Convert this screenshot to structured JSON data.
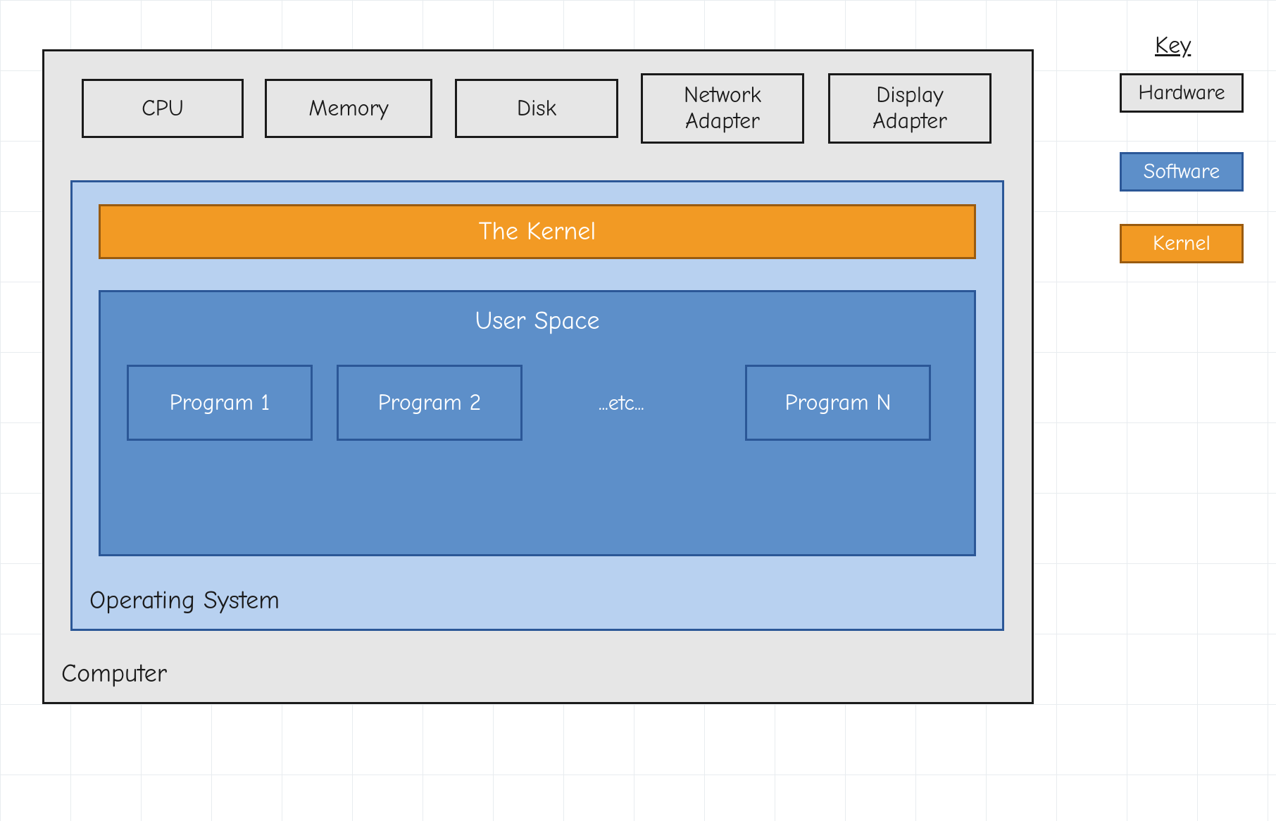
{
  "computer": {
    "label": "Computer",
    "hardware": [
      "CPU",
      "Memory",
      "Disk",
      "Network\nAdapter",
      "Display\nAdapter"
    ],
    "os": {
      "label": "Operating System",
      "kernel": "The Kernel",
      "userspace": {
        "label": "User Space",
        "programs": [
          "Program 1",
          "Program 2",
          "Program N"
        ],
        "etc": "...etc..."
      }
    }
  },
  "key": {
    "title": "Key",
    "items": [
      {
        "label": "Hardware",
        "type": "hardware"
      },
      {
        "label": "Software",
        "type": "software"
      },
      {
        "label": "Kernel",
        "type": "kernel"
      }
    ]
  },
  "colors": {
    "hardware_fill": "#e6e6e6",
    "hardware_stroke": "#1a1a1a",
    "software_fill_light": "#b8d1f0",
    "software_fill_dark": "#5d8fc9",
    "software_stroke": "#2b5797",
    "kernel_fill": "#f29a24",
    "kernel_stroke": "#9a5b0f"
  }
}
